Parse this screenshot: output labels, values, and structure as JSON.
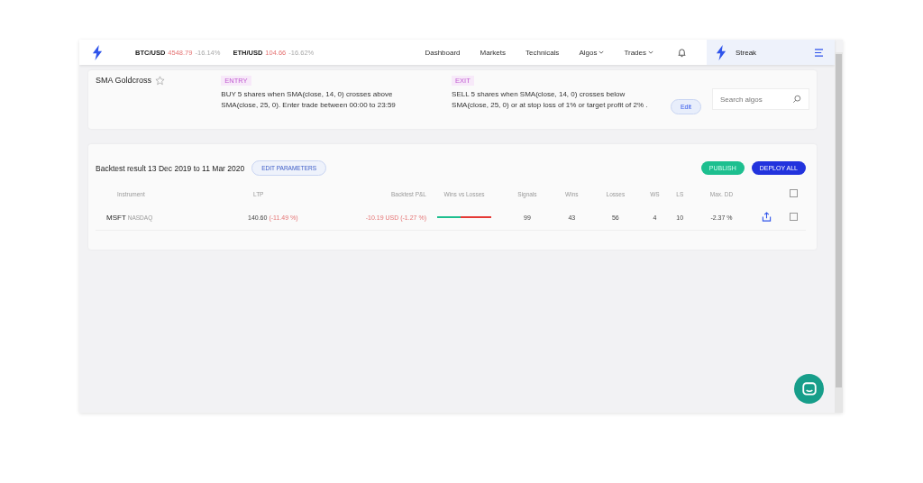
{
  "navbar": {
    "tickers": [
      {
        "symbol": "BTC/USD",
        "price": "4548.79",
        "change": "-16.14%"
      },
      {
        "symbol": "ETH/USD",
        "price": "104.66",
        "change": "-16.62%"
      }
    ],
    "links": [
      {
        "label": "Dashboard",
        "dropdown": false
      },
      {
        "label": "Markets",
        "dropdown": false
      },
      {
        "label": "Technicals",
        "dropdown": false
      },
      {
        "label": "Algos",
        "dropdown": true
      },
      {
        "label": "Trades",
        "dropdown": true
      }
    ],
    "brand": "Streak"
  },
  "algo": {
    "name": "SMA Goldcross",
    "starred": false,
    "entry": {
      "tag": "ENTRY",
      "text": "BUY 5 shares when SMA(close, 14, 0) crosses above SMA(close, 25, 0). Enter trade between 00:00 to 23:59"
    },
    "exit": {
      "tag": "EXIT",
      "text": "SELL 5 shares when SMA(close, 14, 0) crosses below SMA(close, 25, 0) or at stop loss of 1% or target profit of 2% ."
    },
    "edit_button": "Edit",
    "search": {
      "placeholder": "Search algos"
    }
  },
  "backtest": {
    "title": "Backtest result 13 Dec 2019 to 11 Mar 2020",
    "edit_parameters": "EDIT PARAMETERS",
    "publish": "PUBLISH",
    "deploy_all": "DEPLOY ALL",
    "columns": [
      "Instrument",
      "LTP",
      "Backtest P&L",
      "Wins vs Losses",
      "Signals",
      "Wins",
      "Losses",
      "WS",
      "LS",
      "Max. DD"
    ],
    "select_all_checked": false,
    "rows": [
      {
        "symbol": "MSFT",
        "exchange": "NASDAQ",
        "ltp": "140.60",
        "ltp_change": "(-11.49 %)",
        "pnl": "-10.19 USD (-1.27 %)",
        "level": 0.43,
        "signals": "99",
        "wins": "43",
        "losses": "56",
        "ws": "4",
        "ls": "10",
        "max_dd": "-2.37 %",
        "checked": false
      }
    ]
  }
}
